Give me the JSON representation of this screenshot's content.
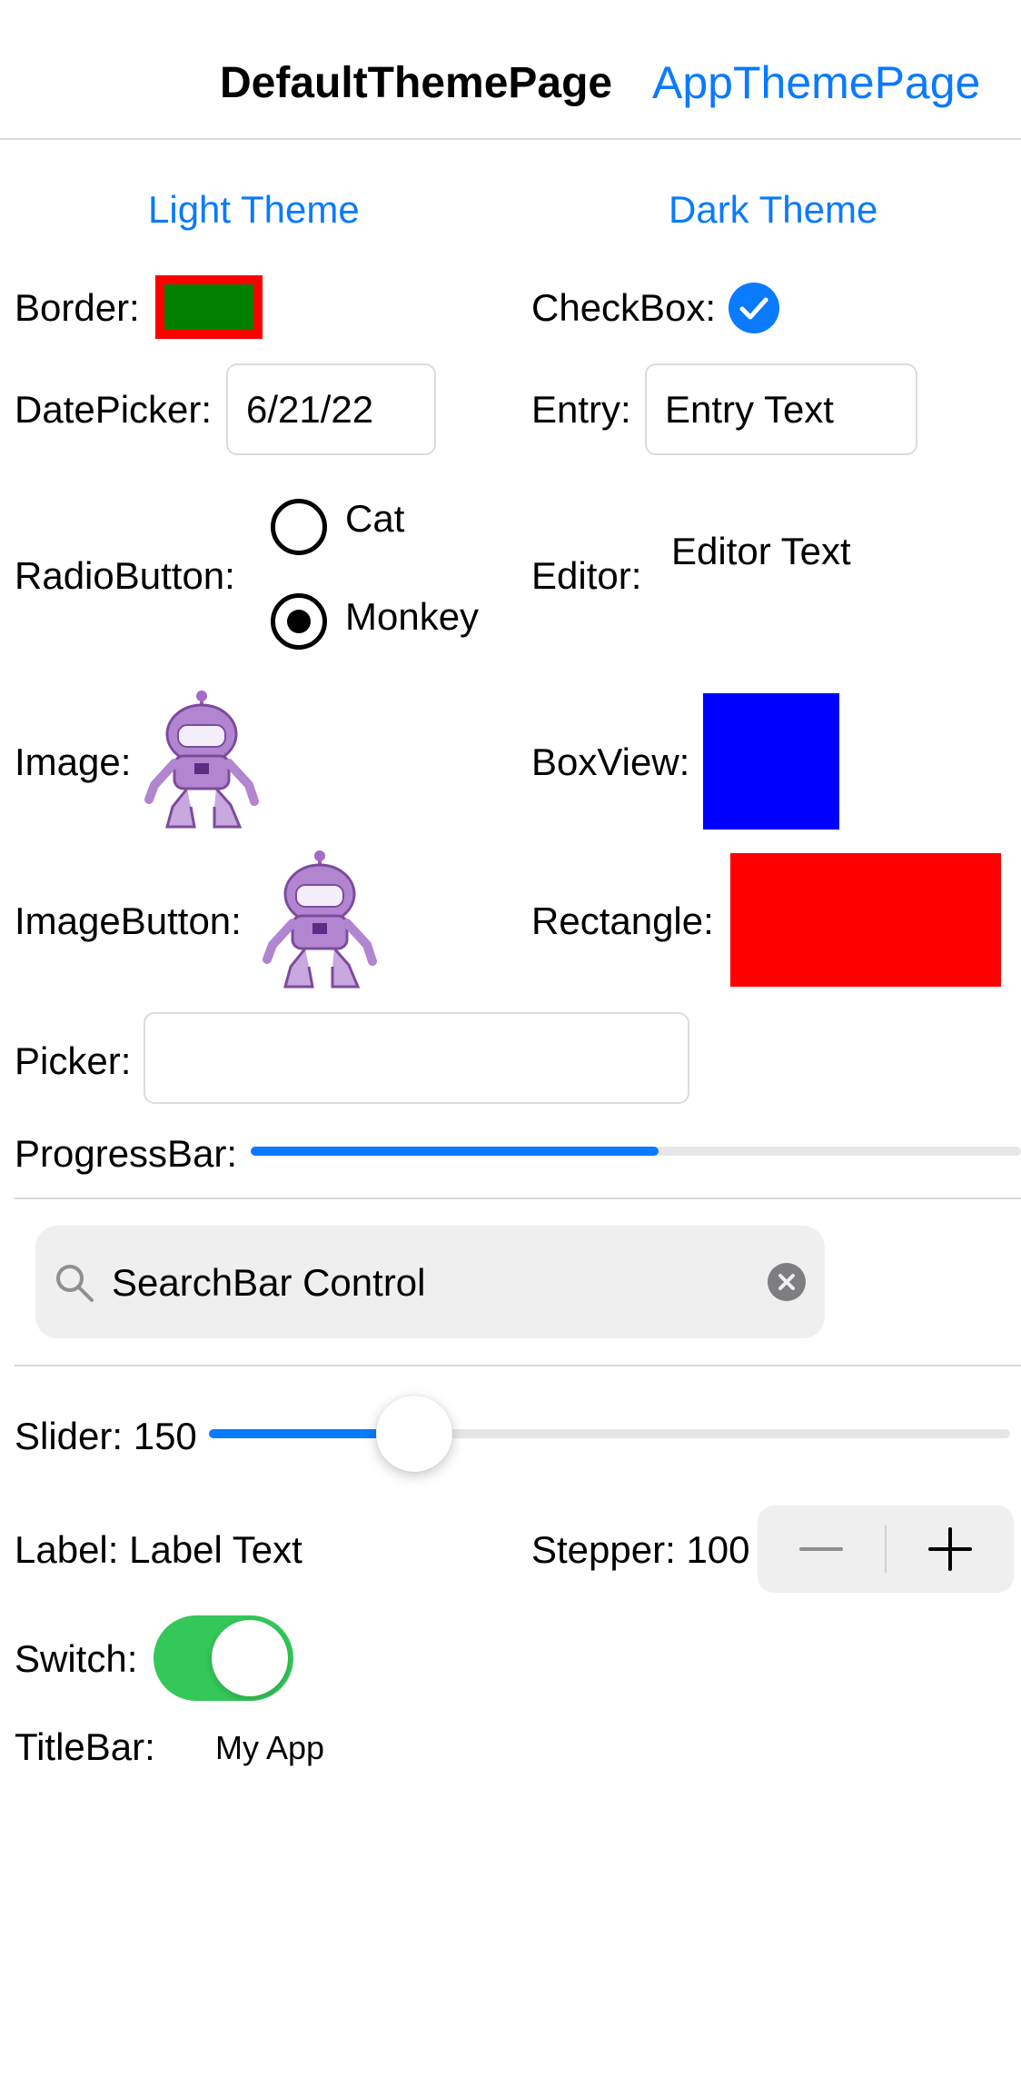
{
  "header": {
    "title": "DefaultThemePage",
    "link": "AppThemePage"
  },
  "themes": {
    "light": "Light Theme",
    "dark": "Dark Theme"
  },
  "border": {
    "label": "Border:"
  },
  "checkbox": {
    "label": "CheckBox:"
  },
  "datepicker": {
    "label": "DatePicker:",
    "value": "6/21/22"
  },
  "entry": {
    "label": "Entry:",
    "value": "Entry Text"
  },
  "radio": {
    "label": "RadioButton:",
    "options": [
      "Cat",
      "Monkey"
    ]
  },
  "editor": {
    "label": "Editor:",
    "value": "Editor Text"
  },
  "image": {
    "label": "Image:"
  },
  "boxview": {
    "label": "BoxView:"
  },
  "imagebutton": {
    "label": "ImageButton:"
  },
  "rectangle": {
    "label": "Rectangle:"
  },
  "picker": {
    "label": "Picker:",
    "value": ""
  },
  "progressbar": {
    "label": "ProgressBar:",
    "progress": 0.53
  },
  "searchbar": {
    "value": "SearchBar Control"
  },
  "slider": {
    "label": "Slider: 150",
    "value": 150,
    "min": 0,
    "max": 650
  },
  "label_ctrl": {
    "label": "Label: Label Text"
  },
  "stepper": {
    "label": "Stepper: 100"
  },
  "switch": {
    "label": "Switch:",
    "on": true
  },
  "titlebar": {
    "label": "TitleBar:",
    "value": "My App"
  },
  "colors": {
    "accent": "#0a7aff",
    "border_stroke": "#ff0000",
    "border_fill": "#008000",
    "boxview": "#0000ff",
    "rectangle": "#ff0000",
    "switch_on": "#34c759"
  }
}
